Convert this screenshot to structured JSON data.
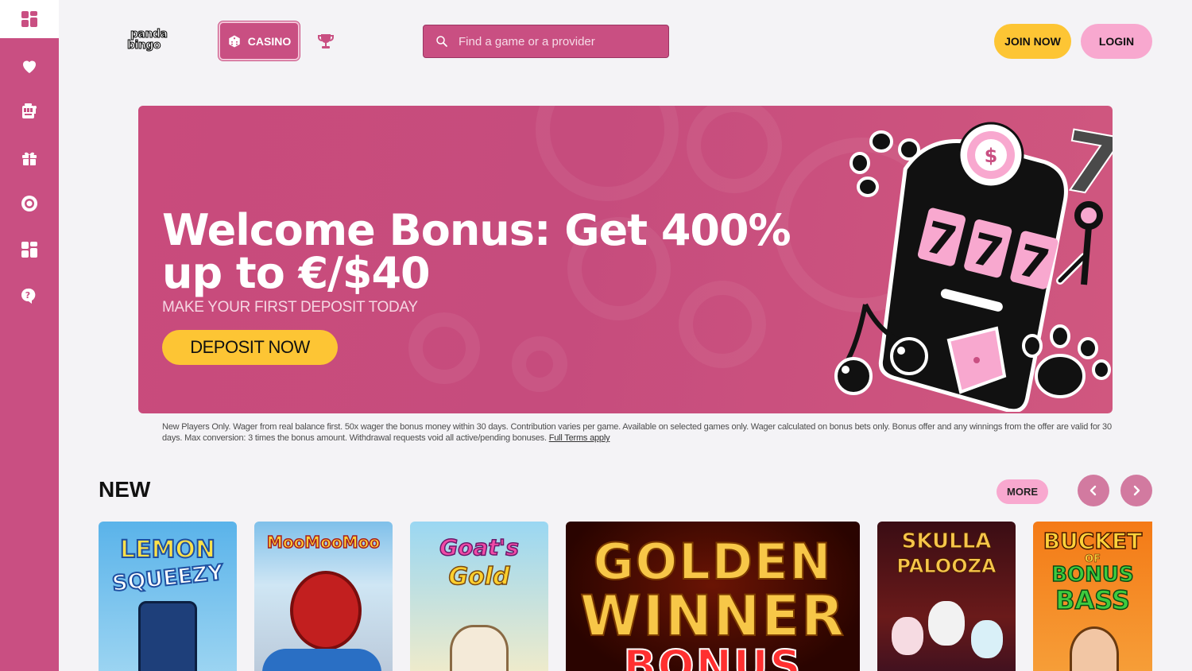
{
  "header": {
    "logo_line1": "panda",
    "logo_line2": "bingo",
    "casino_tab": "CASINO",
    "search_placeholder": "Find a game or a provider",
    "join_label": "JOIN NOW",
    "login_label": "LOGIN"
  },
  "sidebar": {
    "items": [
      "grid-icon",
      "heart-icon",
      "slot-machine-icon",
      "gift-icon",
      "chip-icon",
      "dashboard-icon",
      "help-chat-icon"
    ]
  },
  "banner": {
    "title": "Welcome Bonus: Get 400% up to €/$40",
    "subtitle": "MAKE YOUR FIRST DEPOSIT TODAY",
    "cta": "DEPOSIT NOW"
  },
  "terms": {
    "text": "New Players Only. Wager from real balance first. 50x wager the bonus money within 30 days. Contribution varies per game. Available on selected games only. Wager calculated on bonus bets only. Bonus offer and any winnings from the offer are valid for 30 days. Max conversion: 3 times the bonus amount. Withdrawal requests void all active/pending bonuses.",
    "link": "Full Terms apply"
  },
  "new_section": {
    "title": "NEW",
    "more_label": "MORE",
    "games": [
      {
        "line1": "LEMON",
        "line2": "SQUEEZY"
      },
      {
        "line1": "MooMooMoo",
        "line2": ""
      },
      {
        "line1": "Goat's",
        "line2": "Gold"
      },
      {
        "line1": "GOLDEN",
        "line2": "WINNER",
        "line3": "BONUS"
      },
      {
        "line1": "SKULLA",
        "line2": "PALOOZA"
      },
      {
        "line1": "BUCKET",
        "line2": "OF",
        "line3": "BONUS",
        "line4": "BASS"
      }
    ]
  },
  "colors": {
    "brand_pink": "#c94f82",
    "yellow": "#fdc534",
    "light_pink": "#f8a8cf"
  }
}
